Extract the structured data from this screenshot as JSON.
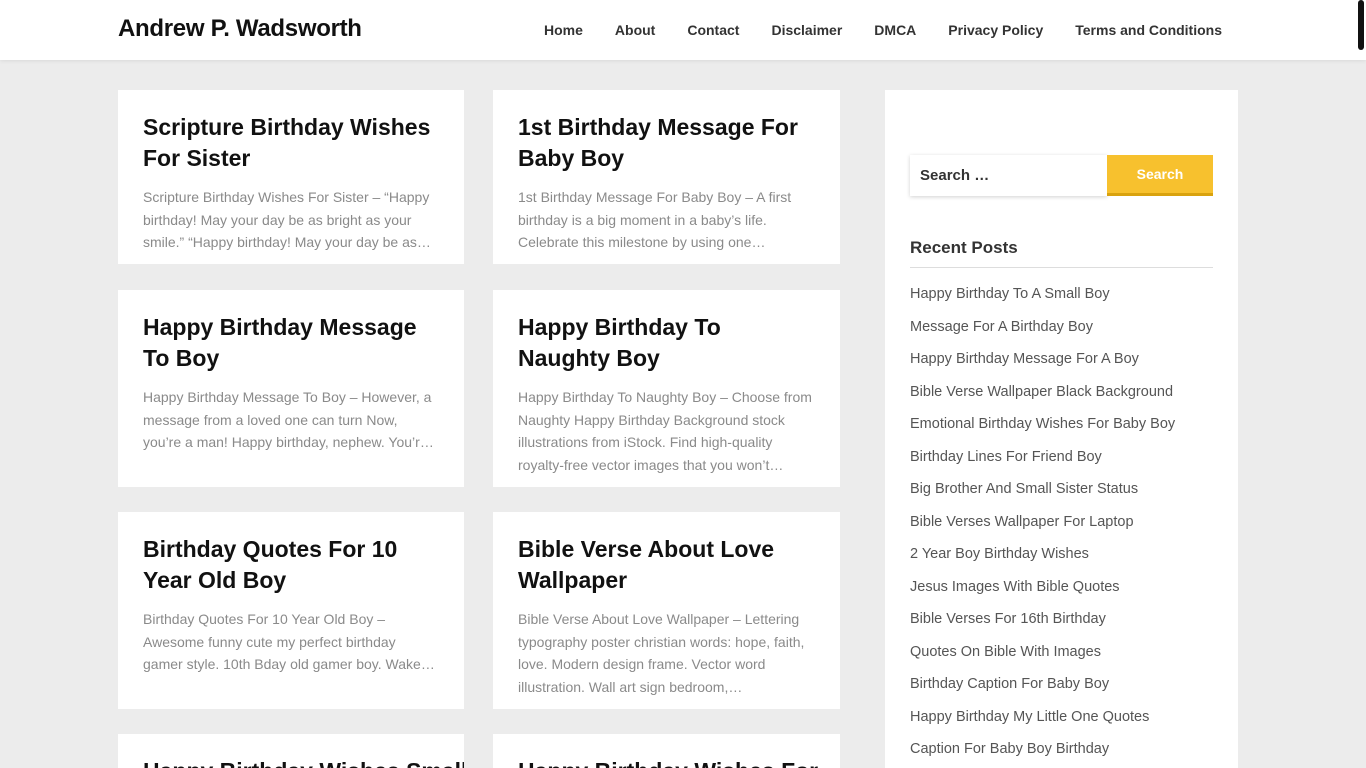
{
  "site": {
    "title": "Andrew P. Wadsworth"
  },
  "nav": [
    "Home",
    "About",
    "Contact",
    "Disclaimer",
    "DMCA",
    "Privacy Policy",
    "Terms and Conditions"
  ],
  "posts": [
    {
      "title": "Scripture Birthday Wishes For Sister",
      "excerpt": "Scripture Birthday Wishes For Sister – “Happy birthday! May your day be as bright as your smile.” “Happy birthday! May your day be as…"
    },
    {
      "title": "1st Birthday Message For Baby Boy",
      "excerpt": "1st Birthday Message For Baby Boy – A first birthday is a big moment in a baby’s life. Celebrate this milestone by using one…"
    },
    {
      "title": "Happy Birthday Message To Boy",
      "excerpt": "Happy Birthday Message To Boy – However, a message from a loved one can turn Now, you’re a man! Happy birthday, nephew. You’re the…"
    },
    {
      "title": "Happy Birthday To Naughty Boy",
      "excerpt": "Happy Birthday To Naughty Boy – Choose from Naughty Happy Birthday Background stock illustrations from iStock. Find high-quality royalty-free vector images that you won’t…"
    },
    {
      "title": "Birthday Quotes For 10 Year Old Boy",
      "excerpt": "Birthday Quotes For 10 Year Old Boy – Awesome funny cute my perfect birthday gamer style. 10th Bday old gamer boy. Wake up, Turn…"
    },
    {
      "title": "Bible Verse About Love Wallpaper",
      "excerpt": "Bible Verse About Love Wallpaper – Lettering typography poster christian words: hope, faith, love. Modern design frame. Vector word illustration. Wall art sign bedroom,…"
    },
    {
      "title": "Happy Birthday Wishes Small",
      "excerpt": ""
    },
    {
      "title": "Happy Birthday Wishes For",
      "excerpt": ""
    }
  ],
  "sidebar": {
    "search": {
      "placeholder": "Search …",
      "button_label": "Search"
    },
    "recent_title": "Recent Posts",
    "recent_posts": [
      "Happy Birthday To A Small Boy",
      "Message For A Birthday Boy",
      "Happy Birthday Message For A Boy",
      "Bible Verse Wallpaper Black Background",
      "Emotional Birthday Wishes For Baby Boy",
      "Birthday Lines For Friend Boy",
      "Big Brother And Small Sister Status",
      "Bible Verses Wallpaper For Laptop",
      "2 Year Boy Birthday Wishes",
      "Jesus Images With Bible Quotes",
      "Bible Verses For 16th Birthday",
      "Quotes On Bible With Images",
      "Birthday Caption For Baby Boy",
      "Happy Birthday My Little One Quotes",
      "Caption For Baby Boy Birthday"
    ]
  },
  "colors": {
    "accent": "#f7c12e",
    "background": "#ececec",
    "card": "#ffffff"
  }
}
